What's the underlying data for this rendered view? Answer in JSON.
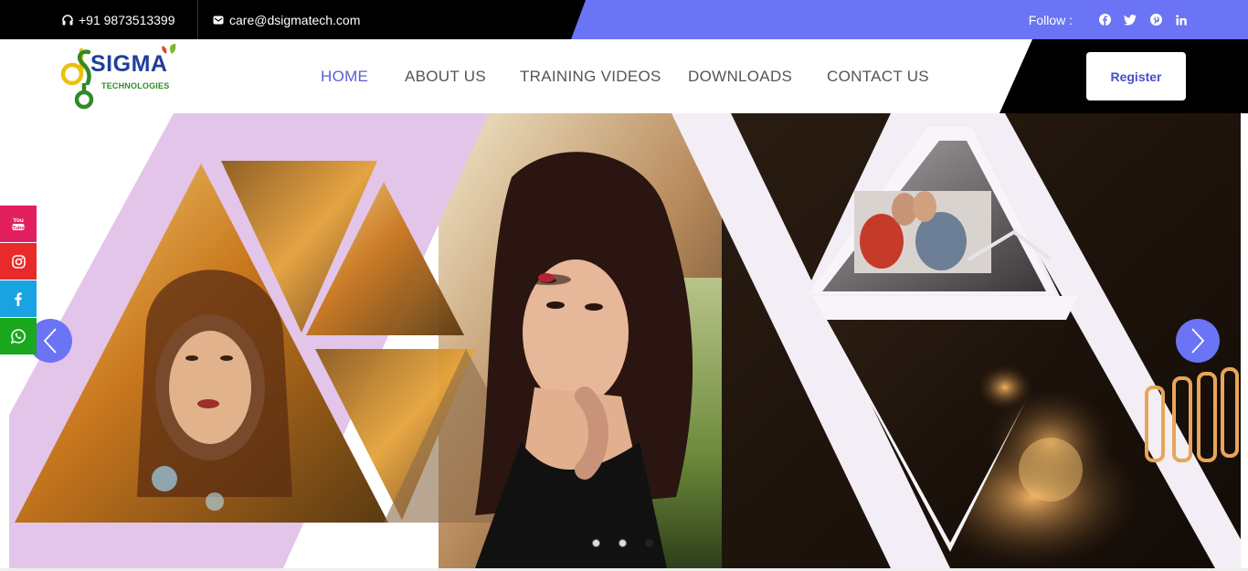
{
  "topbar": {
    "phone": "+91 9873513399",
    "email": "care@dsigmatech.com",
    "follow_label": "Follow :",
    "socials": [
      "facebook-icon",
      "twitter-icon",
      "pinterest-icon",
      "linkedin-icon"
    ]
  },
  "logo": {
    "brand": "SIGMA",
    "subtitle": "TECHNOLOGIES",
    "letters": "ds"
  },
  "nav": {
    "items": [
      {
        "label": "HOME",
        "active": true
      },
      {
        "label": "ABOUT US",
        "active": false
      },
      {
        "label": "TRAINING VIDEOS",
        "active": false
      },
      {
        "label": "DOWNLOADS",
        "active": false
      },
      {
        "label": "CONTACT US",
        "active": false
      }
    ],
    "register_label": "Register"
  },
  "side_social": [
    "youtube-icon",
    "instagram-icon",
    "facebook-icon",
    "whatsapp-icon"
  ],
  "slider": {
    "slide_count": 3,
    "active_slide": 3
  },
  "colors": {
    "accent": "#6a74f4",
    "nav_active": "#5b5fd1",
    "youtube": "#e3205f",
    "instagram": "#e82a2a",
    "facebook": "#1aa3e2",
    "whatsapp": "#1aa81e"
  }
}
